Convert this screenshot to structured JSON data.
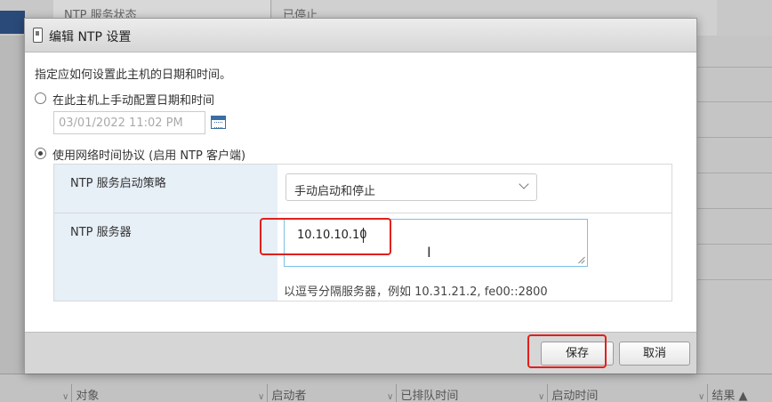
{
  "background": {
    "top_row_label": "NTP 服务状态",
    "top_row_value": "已停止",
    "columns": [
      "对象",
      "启动者",
      "已排队时间",
      "启动时间",
      "结果 ▲"
    ]
  },
  "dialog": {
    "title": "编辑 NTP 设置",
    "intro": "指定应如何设置此主机的日期和时间。",
    "manual_option_label": "在此主机上手动配置日期和时间",
    "manual_datetime": "03/01/2022 11:02 PM",
    "ntp_option_label": "使用网络时间协议 (启用 NTP 客户端)",
    "startup_policy_label": "NTP 服务启动策略",
    "startup_policy_value": "手动启动和停止",
    "servers_label": "NTP 服务器",
    "servers_value": "10.10.10.10",
    "servers_hint": "以逗号分隔服务器，例如 10.31.21.2, fe00::2800",
    "save_label": "保存",
    "cancel_label": "取消"
  },
  "colors": {
    "annotation": "#e0201c",
    "label_cell_bg": "#e7eff7",
    "focus_border": "#7ac1e6"
  }
}
